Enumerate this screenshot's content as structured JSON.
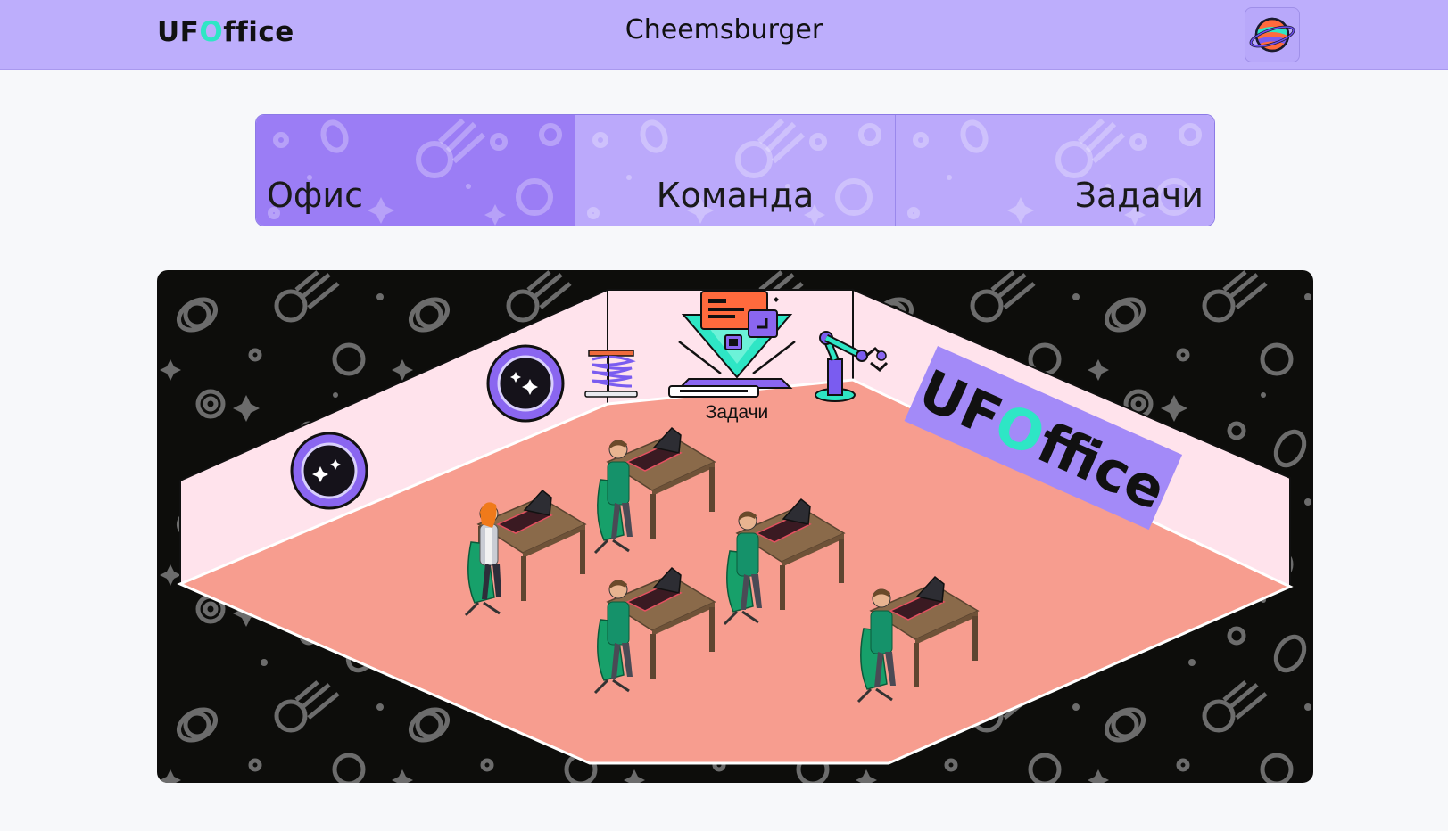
{
  "header": {
    "logo_prefix": "UF",
    "logo_o": "O",
    "logo_suffix": "ffice",
    "title": "Cheemsburger",
    "avatar_icon": "planet-icon"
  },
  "tabs": [
    {
      "label": "Офис",
      "active": true
    },
    {
      "label": "Команда",
      "active": false
    },
    {
      "label": "Задачи",
      "active": false
    }
  ],
  "office": {
    "tasks_label": "Задачи",
    "banner_prefix": "UF",
    "banner_o": "O",
    "banner_suffix": "ffice"
  },
  "colors": {
    "header_bg": "#bdaefc",
    "tab_active": "#9b7df5",
    "tab_inactive": "#bba9fb",
    "accent": "#2ee6c5",
    "floor": "#f79d8f",
    "wall": "#ffe3ec",
    "banner": "#a38af8"
  }
}
